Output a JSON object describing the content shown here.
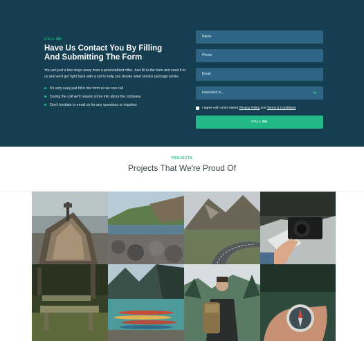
{
  "callme": {
    "kicker": "CALL ME",
    "heading_line1": "Have Us Contact You By Filling",
    "heading_line2": "And Submitting The Form",
    "intro": "You are just a few steps away from a personalized offer. Just fill in the form and send it to us and we'll get right back with a call to help you decide what service package works.",
    "bullets": [
      "It's very easy just fill in the form so we can call",
      "During the call we'll require some info about the company",
      "Don't hesitate to email us for any questions or inquiries"
    ],
    "form": {
      "name_placeholder": "Name",
      "phone_placeholder": "Phone",
      "email_placeholder": "Email",
      "interest_selected": "Interested in...",
      "agree_prefix": "I agree with Aria's stated ",
      "privacy_link": "Privacy Policy",
      "agree_and": " and ",
      "terms_link": "Terms & Conditions",
      "submit_label": "CALL ME"
    }
  },
  "projects": {
    "kicker": "PROJECTS",
    "title": "Projects That We're Proud Of",
    "images": [
      "boat-on-shore",
      "rocky-coast",
      "mountain-road",
      "hand-holding-camera",
      "wooden-bench",
      "canoes-on-lake",
      "hiker-with-backpack",
      "hand-holding-compass"
    ]
  },
  "colors": {
    "section_bg": "#153e51",
    "field_bg": "#2e6585",
    "accent": "#22b987"
  }
}
